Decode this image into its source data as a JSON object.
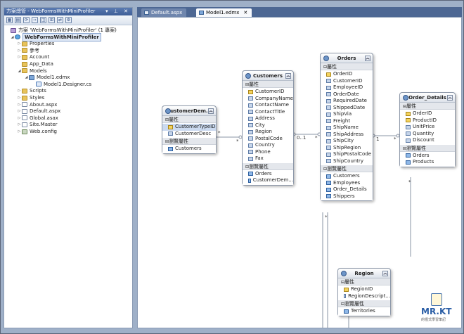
{
  "solution_explorer": {
    "title": "方案總管 - WebFormsWithMiniProfiler",
    "toolbar_icons": [
      "properties-icon",
      "show-all-files-icon",
      "refresh-icon",
      "view-code-icon",
      "view-designer-icon",
      "class-diagram-icon",
      "copy-web-icon",
      "asp-config-icon"
    ],
    "tree": [
      {
        "label": "方案 'WebFormsWithMiniProfiler' (1 專案)",
        "icon": "sol",
        "indent": 0,
        "exp": ""
      },
      {
        "label": "WebFormsWithMiniProfiler",
        "icon": "web",
        "indent": 1,
        "exp": "◢",
        "selected": true
      },
      {
        "label": "Properties",
        "icon": "folder",
        "indent": 2,
        "exp": "▷"
      },
      {
        "label": "參考",
        "icon": "folder",
        "indent": 2,
        "exp": "▷"
      },
      {
        "label": "Account",
        "icon": "folder",
        "indent": 2,
        "exp": "▷"
      },
      {
        "label": "App_Data",
        "icon": "folder",
        "indent": 2,
        "exp": ""
      },
      {
        "label": "Models",
        "icon": "folder",
        "indent": 2,
        "exp": "◢"
      },
      {
        "label": "Model1.edmx",
        "icon": "edmx",
        "indent": 3,
        "exp": "◢"
      },
      {
        "label": "Model1.Designer.cs",
        "icon": "cs",
        "indent": 4,
        "exp": ""
      },
      {
        "label": "Scripts",
        "icon": "folder",
        "indent": 2,
        "exp": "▷"
      },
      {
        "label": "Styles",
        "icon": "folder",
        "indent": 2,
        "exp": "▷"
      },
      {
        "label": "About.aspx",
        "icon": "file",
        "indent": 2,
        "exp": "▷"
      },
      {
        "label": "Default.aspx",
        "icon": "file",
        "indent": 2,
        "exp": "▷"
      },
      {
        "label": "Global.asax",
        "icon": "file",
        "indent": 2,
        "exp": "▷"
      },
      {
        "label": "Site.Master",
        "icon": "file",
        "indent": 2,
        "exp": "▷"
      },
      {
        "label": "Web.config",
        "icon": "cfg",
        "indent": 2,
        "exp": "▷"
      }
    ]
  },
  "tabs": [
    {
      "label": "Default.aspx",
      "active": false
    },
    {
      "label": "Model1.edmx",
      "active": true
    }
  ],
  "section_labels": {
    "props": "屬性",
    "nav": "瀏覽屬性"
  },
  "entities": [
    {
      "id": "customer-demo",
      "title": "CustomerDem...",
      "props": [
        "CustomerTypeID",
        "CustomerDesc"
      ],
      "keys": [
        0
      ],
      "highlight": [
        0
      ],
      "nav": [
        "Customers"
      ]
    },
    {
      "id": "customers",
      "title": "Customers",
      "props": [
        "CustomerID",
        "CompanyName",
        "ContactName",
        "ContactTitle",
        "Address",
        "City",
        "Region",
        "PostalCode",
        "Country",
        "Phone",
        "Fax"
      ],
      "keys": [
        0
      ],
      "highlight": [],
      "nav": [
        "Orders",
        "CustomerDem..."
      ]
    },
    {
      "id": "orders",
      "title": "Orders",
      "props": [
        "OrderID",
        "CustomerID",
        "EmployeeID",
        "OrderDate",
        "RequiredDate",
        "ShippedDate",
        "ShipVia",
        "Freight",
        "ShipName",
        "ShipAddress",
        "ShipCity",
        "ShipRegion",
        "ShipPostalCode",
        "ShipCountry"
      ],
      "keys": [
        0
      ],
      "highlight": [],
      "nav": [
        "Customers",
        "Employees",
        "Order_Details",
        "Shippers"
      ]
    },
    {
      "id": "order-details",
      "title": "Order_Details",
      "props": [
        "OrderID",
        "ProductID",
        "UnitPrice",
        "Quantity",
        "Discount"
      ],
      "keys": [
        0,
        1
      ],
      "highlight": [],
      "nav": [
        "Orders",
        "Products"
      ]
    },
    {
      "id": "region",
      "title": "Region",
      "props": [
        "RegionID",
        "RegionDescript..."
      ],
      "keys": [
        0
      ],
      "highlight": [],
      "nav": [
        "Territories"
      ]
    }
  ],
  "multiplicity": {
    "m1": "*",
    "m2": "*",
    "m3": "0..1",
    "m4": "*",
    "m5": "1",
    "m6": "*",
    "m7": "*",
    "m8": "*"
  },
  "logo": {
    "wordmark": "MR.KT",
    "caption": "的惺式學習筆記"
  }
}
